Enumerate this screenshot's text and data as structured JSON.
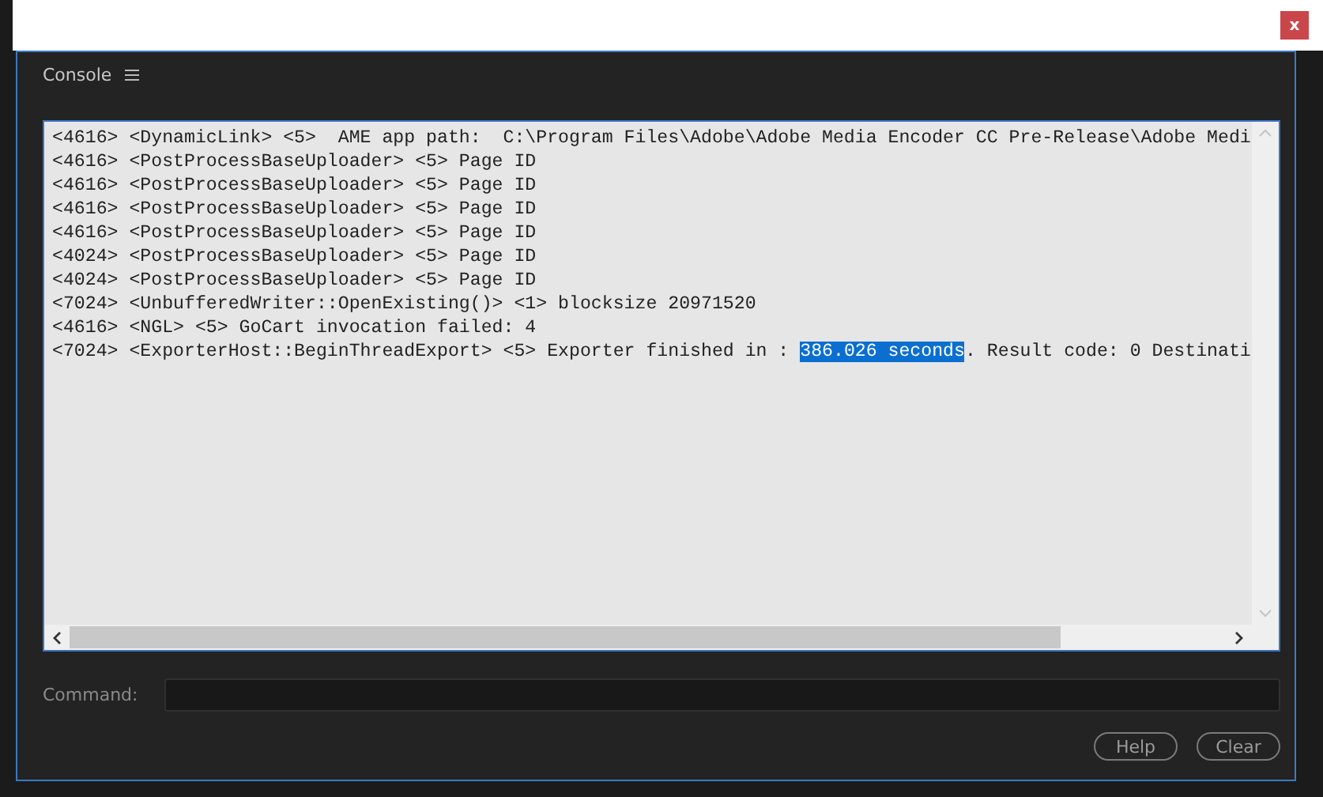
{
  "window": {
    "close_label": "x"
  },
  "panel": {
    "title": "Console"
  },
  "log": {
    "lines": [
      [
        {
          "text": "<4616> <DynamicLink> <5>  AME app path:  C:\\Program Files\\Adobe\\Adobe Media Encoder CC Pre-Release\\Adobe Medi",
          "selected": false
        }
      ],
      [
        {
          "text": "<4616> <PostProcessBaseUploader> <5> Page ID",
          "selected": false
        }
      ],
      [
        {
          "text": "<4616> <PostProcessBaseUploader> <5> Page ID",
          "selected": false
        }
      ],
      [
        {
          "text": "<4616> <PostProcessBaseUploader> <5> Page ID",
          "selected": false
        }
      ],
      [
        {
          "text": "<4616> <PostProcessBaseUploader> <5> Page ID",
          "selected": false
        }
      ],
      [
        {
          "text": "<4024> <PostProcessBaseUploader> <5> Page ID",
          "selected": false
        }
      ],
      [
        {
          "text": "<4024> <PostProcessBaseUploader> <5> Page ID",
          "selected": false
        }
      ],
      [
        {
          "text": "<7024> <UnbufferedWriter::OpenExisting()> <1> blocksize 20971520",
          "selected": false
        }
      ],
      [
        {
          "text": "<4616> <NGL> <5> GoCart invocation failed: 4",
          "selected": false
        }
      ],
      [
        {
          "text": "<7024> <ExporterHost::BeginThreadExport> <5> Exporter finished in : ",
          "selected": false
        },
        {
          "text": "386.026 seconds",
          "selected": true
        },
        {
          "text": ". Result code: 0 Destinati",
          "selected": false
        }
      ]
    ]
  },
  "command": {
    "label": "Command:"
  },
  "buttons": [
    "Help",
    "Clear"
  ]
}
